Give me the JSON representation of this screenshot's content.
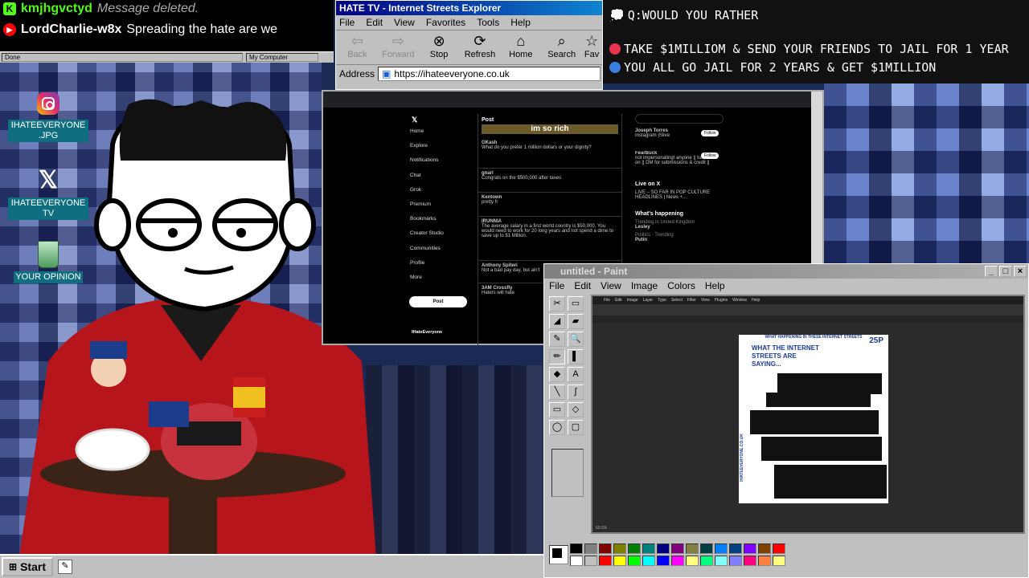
{
  "chat": {
    "messages": [
      {
        "user": "kmjhgvctyd",
        "text": "Message deleted.",
        "badge": "K",
        "badge_color": "#53fc18",
        "user_color": "#53fc18"
      },
      {
        "user": "LordCharlie-w8x",
        "text": "Spreading the hate are we",
        "badge": "▶",
        "badge_color": "#ff0000",
        "user_color": "#ffffff"
      }
    ]
  },
  "statusbar": {
    "left": "Done",
    "right": "My Computer"
  },
  "desktop": {
    "icons": [
      {
        "label": "IHATEEVERYONE .JPG",
        "icon": "instagram-icon"
      },
      {
        "label": "IHATEEVERYONE TV",
        "icon": "x-logo-icon"
      },
      {
        "label": "YOUR OPINION",
        "icon": "recycle-bin-icon"
      }
    ]
  },
  "browser": {
    "title": "HATE TV - Internet Streets Explorer",
    "menu": [
      "File",
      "Edit",
      "View",
      "Favorites",
      "Tools",
      "Help"
    ],
    "toolbar": [
      {
        "label": "Back",
        "icon": "arrow-left-icon",
        "enabled": false
      },
      {
        "label": "Forward",
        "icon": "arrow-right-icon",
        "enabled": false
      },
      {
        "label": "Stop",
        "icon": "stop-icon",
        "enabled": true
      },
      {
        "label": "Refresh",
        "icon": "refresh-icon",
        "enabled": true
      },
      {
        "label": "Home",
        "icon": "home-icon",
        "enabled": true
      },
      {
        "label": "Search",
        "icon": "search-icon",
        "enabled": true
      },
      {
        "label": "Fav",
        "icon": "star-icon",
        "enabled": true
      }
    ],
    "address_label": "Address",
    "url": "https://ihateeveryone.co.uk"
  },
  "question": {
    "prompt": "Q:WOULD YOU RATHER",
    "options": [
      {
        "text": "TAKE $1MILLIOM & SEND YOUR FRIENDS TO JAIL FOR 1 YEAR",
        "color": "#e8344d"
      },
      {
        "text": "YOU ALL GO JAIL FOR 2 YEARS & GET $1MILLION",
        "color": "#3a7fe0"
      }
    ]
  },
  "twitter": {
    "nav": [
      "Home",
      "Explore",
      "Notifications",
      "Chat",
      "Grok",
      "Premium",
      "Bookmarks",
      "Creator Studio",
      "Communities",
      "Profile",
      "More"
    ],
    "post_button": "Post",
    "header": "Post",
    "banner": "im so rich",
    "posts": [
      {
        "name": "GKash",
        "text": "What do you prefer 1 million dollars or your dignity?"
      },
      {
        "name": "gnarl",
        "text": "Congrats on the $500,000 after taxes"
      },
      {
        "name": "Kentown",
        "text": "pretty fr"
      },
      {
        "name": "IRUNNIA",
        "text": "The average salary in a first world country is $50,000. You would need to work for 20 long years and not spend a dime to save up to $1 Million."
      },
      {
        "name": "Anthony Spiteri",
        "text": "Not a bad pay day, but ain't"
      },
      {
        "name": "3AM Crossfly",
        "text": "Haters will hate"
      }
    ],
    "rail": {
      "follow": [
        {
          "name": "Joseph Torres",
          "sub": "Instagram |Slive",
          "button": "Follow"
        },
        {
          "name": "FearBuck",
          "sub": "not impersonating! anyone || turn notis on || DM for submissions & credit ||",
          "button": "Follow"
        }
      ],
      "live_title": "Live on X",
      "live_text": "LIVE – SO FAR IN POP CULTURE HEADLINES | News +...",
      "happening_title": "What's happening",
      "trends": [
        {
          "context": "Trending in United Kingdom",
          "name": "Lesley"
        },
        {
          "context": "Politics · Trending",
          "name": "Putin"
        }
      ],
      "profile_name": "IHateEveryone"
    }
  },
  "paint": {
    "title": "untitled - Paint",
    "menu": [
      "File",
      "Edit",
      "View",
      "Image",
      "Colors",
      "Help"
    ],
    "tools": [
      "✂",
      "▭",
      "◢",
      "▰",
      "✎",
      "🔍",
      "✏",
      "▌",
      "◆",
      "A",
      "╲",
      "∫",
      "▭",
      "◇",
      "◯",
      "▢"
    ],
    "palette": [
      "#000000",
      "#808080",
      "#800000",
      "#808000",
      "#008000",
      "#008080",
      "#000080",
      "#800080",
      "#808040",
      "#004040",
      "#0080ff",
      "#004080",
      "#8000ff",
      "#804000",
      "#ff0000",
      "#ffffff",
      "#c0c0c0",
      "#ff0000",
      "#ffff00",
      "#00ff00",
      "#00ffff",
      "#0000ff",
      "#ff00ff",
      "#ffff80",
      "#00ff80",
      "#80ffff",
      "#8080ff",
      "#ff0080",
      "#ff8040",
      "#ffff80"
    ],
    "psd": {
      "menu": [
        "File",
        "Edit",
        "Image",
        "Layer",
        "Type",
        "Select",
        "Filter",
        "View",
        "Plugins",
        "Window",
        "Help"
      ],
      "zoom": "60.5%",
      "doc_header": "WHAT HAPPENING IN THESE INTERNET STREETS",
      "doc_title": "WHAT THE INTERNET STREETS ARE SAYING...",
      "doc_page": "25P",
      "doc_side": "IHATEEVERYONE.CO.UK"
    }
  },
  "taskbar": {
    "start": "Start"
  }
}
